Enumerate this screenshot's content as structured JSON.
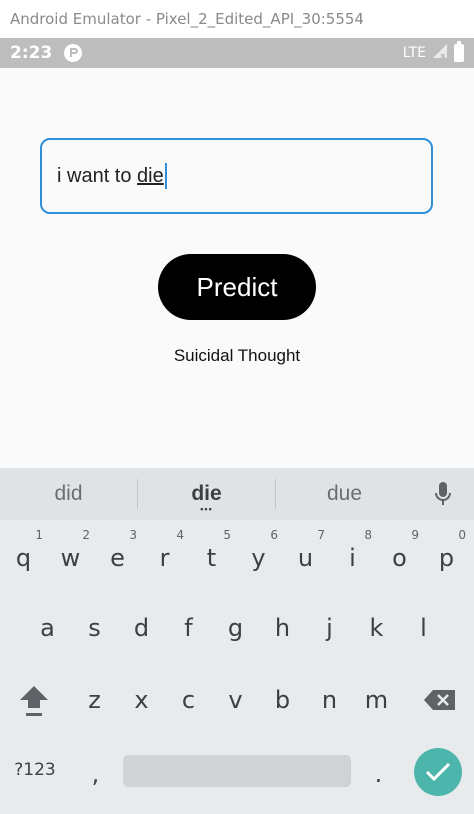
{
  "window": {
    "title": "Android Emulator - Pixel_2_Edited_API_30:5554"
  },
  "status_bar": {
    "time": "2:23",
    "network": "LTE"
  },
  "app": {
    "input": {
      "prefix": "i want to ",
      "current_word": "die"
    },
    "predict_label": "Predict",
    "result": "Suicidal Thought"
  },
  "keyboard": {
    "suggestions": [
      "did",
      "die",
      "due"
    ],
    "row1": [
      {
        "key": "q",
        "num": "1"
      },
      {
        "key": "w",
        "num": "2"
      },
      {
        "key": "e",
        "num": "3"
      },
      {
        "key": "r",
        "num": "4"
      },
      {
        "key": "t",
        "num": "5"
      },
      {
        "key": "y",
        "num": "6"
      },
      {
        "key": "u",
        "num": "7"
      },
      {
        "key": "i",
        "num": "8"
      },
      {
        "key": "o",
        "num": "9"
      },
      {
        "key": "p",
        "num": "0"
      }
    ],
    "row2": [
      "a",
      "s",
      "d",
      "f",
      "g",
      "h",
      "j",
      "k",
      "l"
    ],
    "row3": [
      "z",
      "x",
      "c",
      "v",
      "b",
      "n",
      "m"
    ],
    "symbols_label": "?123",
    "comma": ",",
    "period": "."
  },
  "colors": {
    "accent": "#2f8fd8",
    "done": "#4db6ac",
    "button": "#000000"
  }
}
